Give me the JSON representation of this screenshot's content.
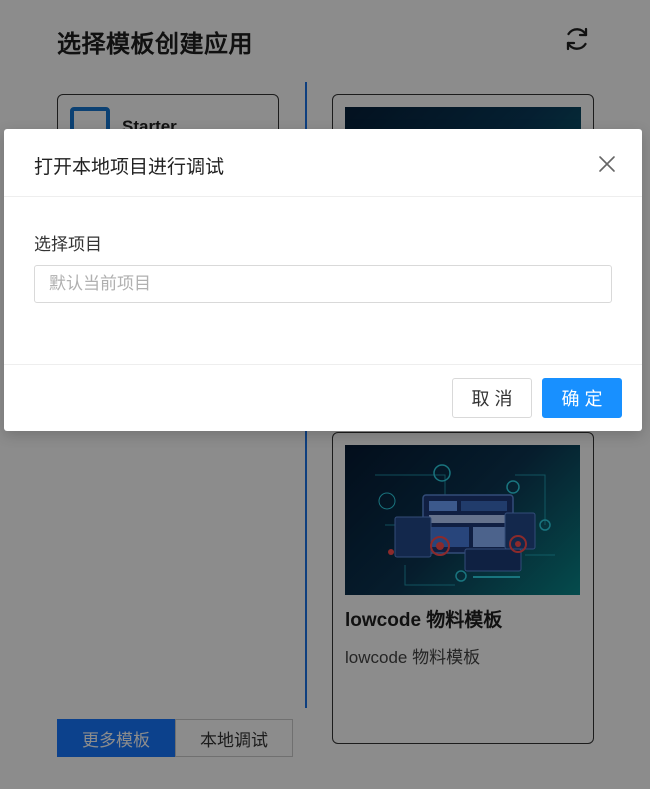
{
  "page": {
    "title": "选择模板创建应用"
  },
  "templates": {
    "starter_label": "Starter",
    "lowcode_card": {
      "title": "lowcode 物料模板",
      "description": "lowcode 物料模板"
    }
  },
  "bottom_buttons": {
    "more_label": "更多模板",
    "local_label": "本地调试"
  },
  "modal": {
    "title": "打开本地项目进行调试",
    "field_label": "选择项目",
    "input_placeholder": "默认当前项目",
    "input_value": "",
    "cancel_label": "取 消",
    "ok_label": "确 定"
  },
  "colors": {
    "primary": "#1890ff",
    "divider": "#1a73e8",
    "overlay": "rgba(0,0,0,0.45)"
  },
  "icons": {
    "refresh": "refresh-icon",
    "close": "close-icon"
  }
}
